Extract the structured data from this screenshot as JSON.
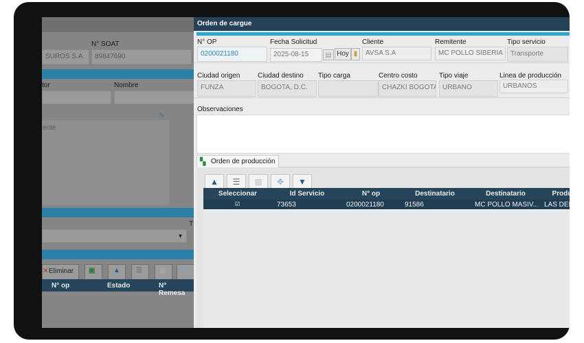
{
  "background_window": {
    "soat_label": "N° SOAT",
    "insurer_value": "SUROS S.A.",
    "soat_value": "89847690",
    "conductor_label": "tor",
    "nombre_label": "Nombre",
    "side_text": "ente",
    "toolbar": {
      "delete_label": "Eliminar"
    },
    "grid_headers": [
      "N° op",
      "Estado",
      "N° Remesa"
    ],
    "letter_t": "T"
  },
  "dialog": {
    "title": "Orden de cargue",
    "fields_row1": {
      "op_label": "N° OP",
      "op_value": "0200021180",
      "fecha_label": "Fecha Solicitud",
      "fecha_value": "2025-08-15",
      "hoy_label": "Hoy",
      "cliente_label": "Cliente",
      "cliente_value": "AVSA S.A",
      "remitente_label": "Remitente",
      "remitente_value": "MC POLLO SIBERIA",
      "tipo_servicio_label": "Tipo servicio",
      "tipo_servicio_value": "Transporte"
    },
    "fields_row2": {
      "ciudad_origen_label": "Ciudad origen",
      "ciudad_origen_value": "FUNZA",
      "ciudad_destino_label": "Ciudad destino",
      "ciudad_destino_value": "BOGOTA, D.C.",
      "tipo_carga_label": "Tipo carga",
      "tipo_carga_value": "",
      "centro_costo_label": "Centro costo",
      "centro_costo_value": "CHAZKI BOGOTA",
      "tipo_viaje_label": "Tipo viaje",
      "tipo_viaje_value": "URBANO",
      "linea_label": "Linea de producción",
      "linea_value": "URBANOS"
    },
    "observaciones_label": "Observaciones",
    "tab_label": "Orden de producción",
    "grid": {
      "headers": [
        "Seleccionar",
        "Id Servicio",
        "N° op",
        "Destinatario",
        "Destinatario",
        "Produ"
      ],
      "rows": [
        {
          "check": "☑",
          "id_servicio": "73653",
          "n_op": "0200021180",
          "destinatario_id": "91586",
          "destinatario_nombre": "MC POLLO MASIV...",
          "producto": "LAS DEM"
        }
      ]
    }
  },
  "colors": {
    "header_navy": "#26455a",
    "accent_blue": "#2ea6cf",
    "title_bar": "#254158"
  }
}
